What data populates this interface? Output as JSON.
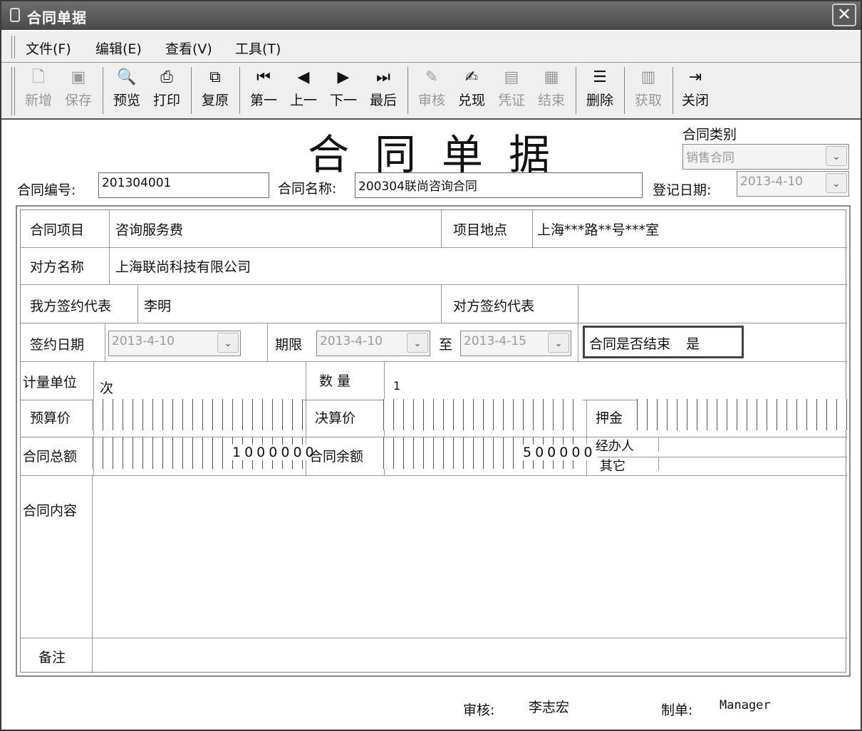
{
  "window": {
    "title": "合同单据",
    "close_symbol": "✕"
  },
  "menu": [
    "文件(F)",
    "编辑(E)",
    "查看(V)",
    "工具(T)"
  ],
  "toolbar": {
    "new": "新增",
    "save": "保存",
    "preview": "预览",
    "print": "打印",
    "restore": "复原",
    "first": "第一",
    "prev": "上一",
    "next": "下一",
    "last": "最后",
    "audit": "审核",
    "cash": "兑现",
    "voucher": "凭证",
    "finish": "结束",
    "delete": "删除",
    "fetch": "获取",
    "close": "关闭"
  },
  "form": {
    "big_title": "合同单据",
    "category_label": "合同类别",
    "category_value": "销售合同",
    "number_label": "合同编号:",
    "number_value": "201304001",
    "name_label": "合同名称:",
    "name_value": "200304联尚咨询合同",
    "reg_date_label": "登记日期:",
    "reg_date_value": "2013-4-10"
  },
  "grid": {
    "item_label": "合同项目",
    "item_value": "咨询服务费",
    "location_label": "项目地点",
    "location_value": "上海***路**号***室",
    "party_label": "对方名称",
    "party_value": "上海联尚科技有限公司",
    "our_rep_label": "我方签约代表",
    "our_rep_value": "李明",
    "their_rep_label": "对方签约代表",
    "their_rep_value": "",
    "sign_date_label": "签约日期",
    "sign_date_value": "2013-4-10",
    "term_label": "期限",
    "term_from": "2013-4-10",
    "to_label": "至",
    "term_to": "2013-4-15",
    "ended_label": "合同是否结束",
    "ended_value": "是",
    "unit_label": "计量单位",
    "unit_value": "次",
    "qty_label": "数 量",
    "qty_value": "1",
    "budget_label": "预算价",
    "final_label": "决算价",
    "deposit_label": "押金",
    "total_label": "合同总额",
    "total_value": "1000000",
    "balance_label": "合同余额",
    "balance_value": "500000",
    "handler_label": "经办人",
    "other_label": "其它",
    "content_label": "合同内容",
    "remark_label": "备注"
  },
  "footer": {
    "auditor_label": "审核:",
    "auditor_value": "李志宏",
    "maker_label": "制单:",
    "maker_value": "Manager"
  },
  "icons": {
    "new": "new-doc-icon",
    "save": "save-disk-icon",
    "preview": "preview-icon",
    "print": "printer-icon",
    "restore": "restore-icon",
    "first": "first-record-icon",
    "prev": "prev-record-icon",
    "next": "next-record-icon",
    "last": "last-record-icon",
    "audit": "audit-icon",
    "cash": "cash-icon",
    "voucher": "voucher-icon",
    "finish": "finish-icon",
    "delete": "delete-icon",
    "fetch": "fetch-icon",
    "close": "exit-icon"
  }
}
